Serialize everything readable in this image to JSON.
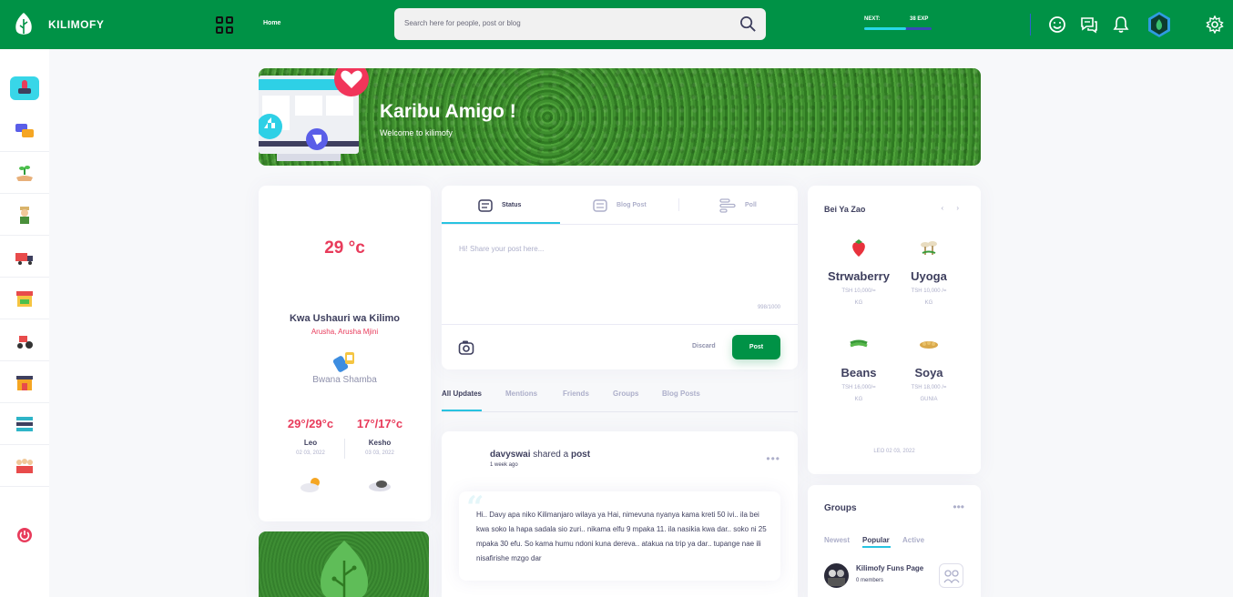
{
  "header": {
    "brand": "KILIMOFY",
    "nav_home": "Home",
    "search_placeholder": "Search here for people, post or blog",
    "next_label": "NEXT:",
    "exp_label": "38 EXP",
    "exp_progress_pct": 62
  },
  "banner": {
    "title": "Karibu Amigo !",
    "subtitle": "Welcome to kilimofy"
  },
  "weather": {
    "temperature": "29 °c",
    "title": "Kwa Ushauri wa Kilimo",
    "location": "Arusha, Arusha Mjini",
    "brand": "Bwana Shamba",
    "forecast": [
      {
        "temp": "29°/29°c",
        "day": "Leo",
        "date": "02 03, 2022"
      },
      {
        "temp": "17°/17°c",
        "day": "Kesho",
        "date": "03 03, 2022"
      }
    ]
  },
  "composer": {
    "tabs": [
      {
        "label": "Status"
      },
      {
        "label": "Blog Post"
      },
      {
        "label": "Poll"
      }
    ],
    "placeholder": "Hi! Share your post here...",
    "count": "998/1000",
    "discard": "Discard",
    "post": "Post"
  },
  "filters": [
    "All Updates",
    "Mentions",
    "Friends",
    "Groups",
    "Blog Posts"
  ],
  "post": {
    "author": "davyswai",
    "action": "shared a",
    "object": "post",
    "time": "1 week ago",
    "dots": "•••",
    "text": "Hi.. Davy apa niko Kilimanjaro wilaya ya Hai, nimevuna nyanya kama kreti 50 ivi.. ila bei kwa soko la hapa sadala sio zuri.. nikama elfu 9 mpaka 11. ila nasikia kwa dar.. soko ni 25 mpaka 30 efu. So kama humu ndoni kuna dereva.. atakua na trip ya dar.. tupange nae ili nisafirishe mzgo dar"
  },
  "market": {
    "title": "Bei Ya Zao",
    "arrows": "‹ ›",
    "items": [
      {
        "name": "Strwaberry",
        "price": "TSH 10,000/=",
        "unit": "KG"
      },
      {
        "name": "Uyoga",
        "price": "TSH 10,000 /=",
        "unit": "KG"
      },
      {
        "name": "Beans",
        "price": "TSH 16,000/=",
        "unit": "KG"
      },
      {
        "name": "Soya",
        "price": "TSH 18,000 /=",
        "unit": "GUNIA"
      }
    ],
    "date": "LEO 02 03, 2022"
  },
  "groups": {
    "title": "Groups",
    "dots": "•••",
    "tabs": [
      "Newest",
      "Popular",
      "Active"
    ],
    "item_name": "Kilimofy Funs Page",
    "item_members": "0 members"
  },
  "colors": {
    "primary_green": "#009246",
    "accent_red": "#e83b5b",
    "accent_cyan": "#28c3e0"
  }
}
